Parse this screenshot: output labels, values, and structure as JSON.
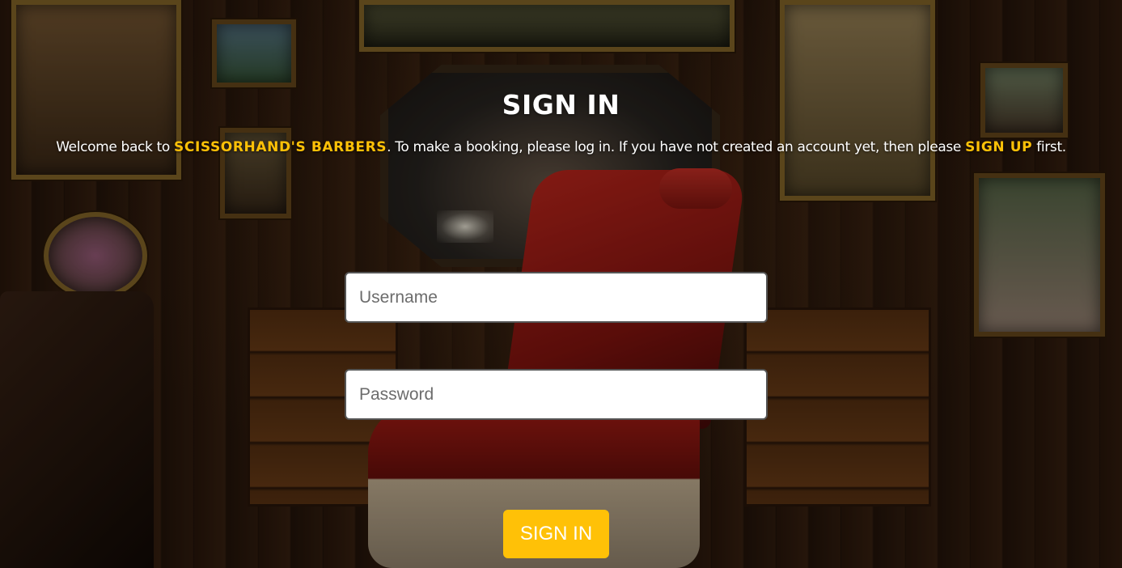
{
  "page": {
    "title": "SIGN IN",
    "intro": {
      "text_before": "Welcome back to ",
      "brand": "SCISSORHAND'S BARBERS",
      "text_middle": ". To make a booking, please log in. If you have not created an account yet, then please ",
      "signup_link": "SIGN UP",
      "text_after": " first."
    }
  },
  "form": {
    "username": {
      "placeholder": "Username",
      "value": ""
    },
    "password": {
      "placeholder": "Password",
      "value": ""
    },
    "submit_label": "SIGN IN"
  },
  "colors": {
    "accent": "#ffc107",
    "text": "#ffffff"
  }
}
